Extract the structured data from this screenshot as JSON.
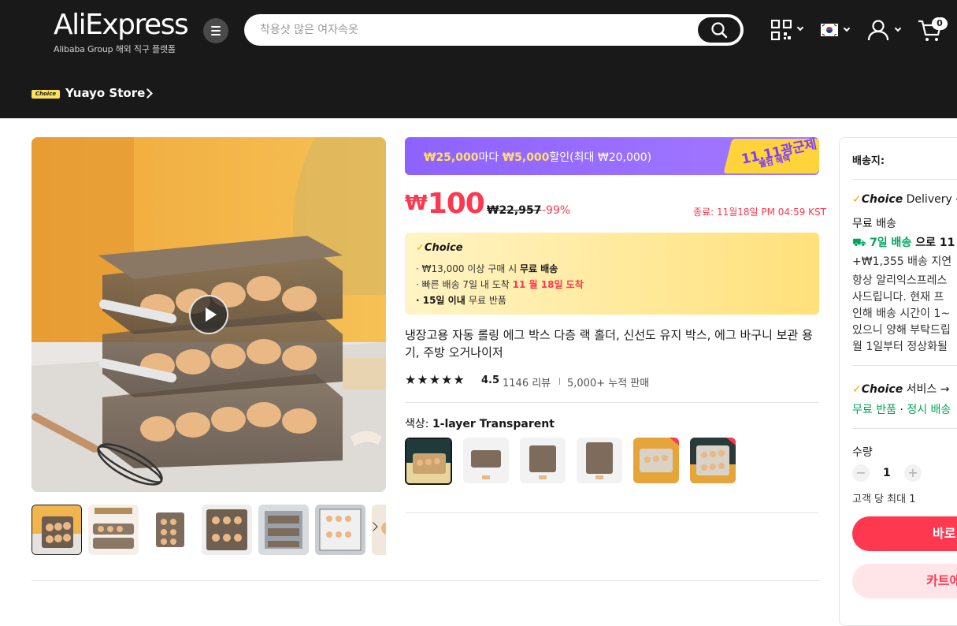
{
  "header": {
    "logo": "AliExpress",
    "logo_sub": "Alibaba Group 해외 직구 플랫폼",
    "search_placeholder": "착용샷 많은 여자속옷",
    "cart_count": "0"
  },
  "store": {
    "badge": "Choice",
    "name": "Yuayo Store"
  },
  "promo": {
    "amount1": "₩25,000",
    "text1": "마다 ",
    "amount2": "₩5,000",
    "text2": "할인(최대 ₩20,000)",
    "tag_main": "11.11광군제",
    "tag_sub": "웰컴 혜택"
  },
  "price": {
    "currency": "₩",
    "amount": "100",
    "original": "₩22,957",
    "discount": "-99%",
    "deadline": "종료: 11월18일 PM 04:59 KST"
  },
  "choice_box": {
    "title": "Choice",
    "line1_pre": "· ₩13,000 이상 구매 시 ",
    "line1_bold": "무료 배송",
    "line2_pre": "· 빠른 배송 7일 내 도착 ",
    "line2_red": "11 월 18일 도착",
    "line3_bold": "· 15일 이내  ",
    "line3_rest": "무료 반품"
  },
  "product": {
    "title": "냉장고용 자동 롤링 에그 박스 다층 랙 홀더, 신선도 유지 박스, 에그 바구니 보관 용기, 주방 오거나이저",
    "stars": "★★★★★",
    "rating": "4.5",
    "reviews": "1146 리뷰",
    "sold": "5,000+ 누적 판매",
    "color_label": "색상: ",
    "color_value": "1-layer Transparent"
  },
  "right_panel": {
    "ship_to": "배송지:",
    "choice_delivery": "Delivery →",
    "free_shipping": "무료 배송",
    "fast_delivery_green": "7일 배송",
    "fast_delivery_rest": " 으로 11",
    "delay": "+₩1,355 배송 지연",
    "notice1": "항상 알리익스프레스",
    "notice2": "사드립니다. 현재 프",
    "notice3": "인해 배송 시간이 1~",
    "notice4": "있으니 양해 부탁드립",
    "notice5": "월 1일부터 정상화될",
    "service_label": "서비스 →",
    "service_green1": "무료 반품",
    "service_dot": " · ",
    "service_green2": "정시 배송",
    "qty_label": "수량",
    "qty_value": "1",
    "qty_limit": "고객 당 최대 1",
    "buy_now": "바로",
    "add_cart": "카트에"
  }
}
